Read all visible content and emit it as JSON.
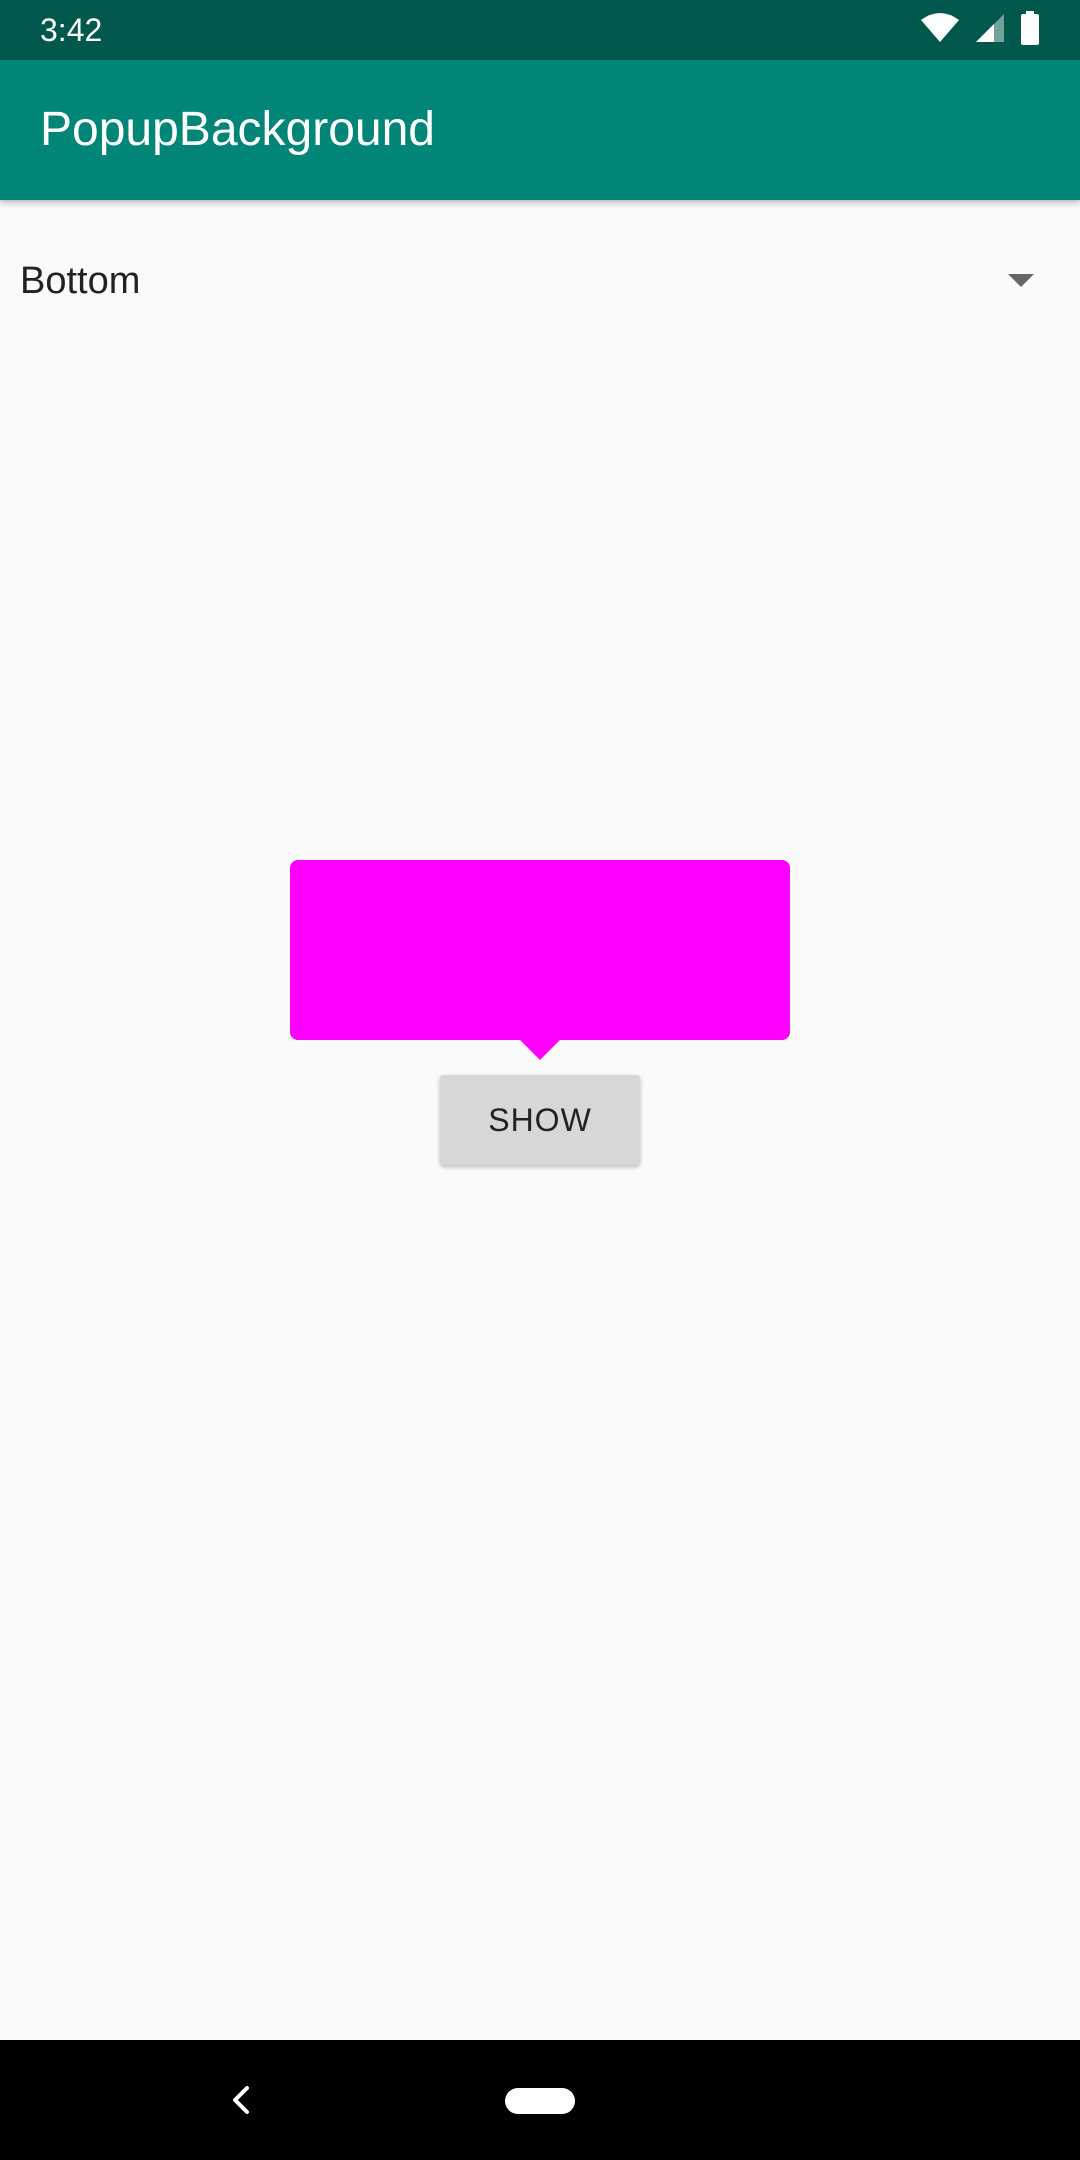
{
  "status_bar": {
    "time": "3:42",
    "icons": [
      "wifi-icon",
      "signal-icon",
      "battery-icon"
    ]
  },
  "app_bar": {
    "title": "PopupBackground"
  },
  "spinner": {
    "selected_value": "Bottom"
  },
  "popup": {
    "color": "#ff00ff"
  },
  "show_button": {
    "label": "SHOW"
  },
  "nav_bar": {
    "icons": [
      "back-icon",
      "home-icon"
    ]
  },
  "colors": {
    "status_bar": "#00574b",
    "app_bar": "#008577",
    "background": "#fafafa",
    "button": "#d6d7d7"
  }
}
